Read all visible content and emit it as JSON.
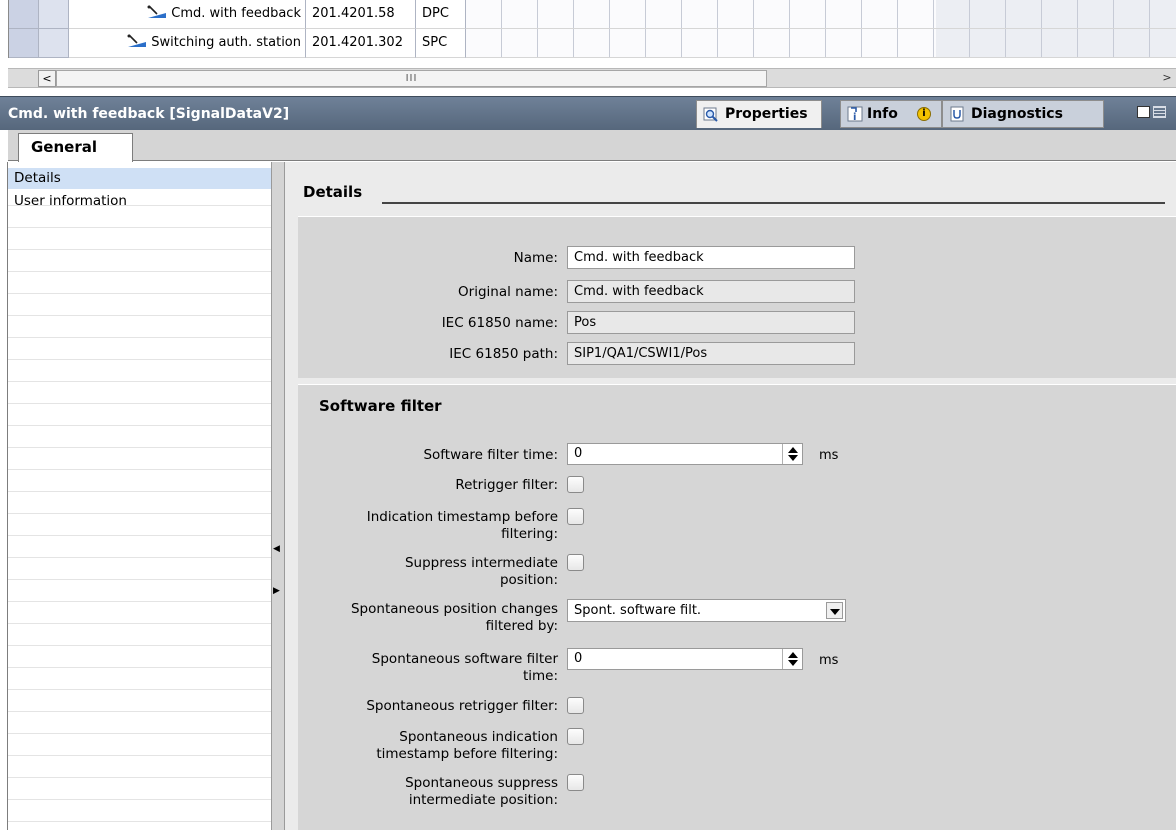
{
  "signal_table": {
    "rows": [
      {
        "name": "Cmd. with feedback",
        "address": "201.4201.58",
        "type": "DPC"
      },
      {
        "name": "Switching auth. station",
        "address": "201.4201.302",
        "type": "SPC"
      }
    ],
    "scroll_left_glyph": "<",
    "scroll_right_glyph": ">",
    "scroll_thumb_glyph": "III"
  },
  "inspector": {
    "title": "Cmd. with feedback [SignalDataV2]",
    "tabs": {
      "properties": "Properties",
      "info": "Info",
      "info_badge": "i",
      "diagnostics": "Diagnostics"
    },
    "general_tab": "General"
  },
  "left_nav": {
    "items": [
      {
        "label": "Details",
        "selected": true
      },
      {
        "label": "User information",
        "selected": false
      }
    ]
  },
  "details": {
    "heading": "Details",
    "name_label": "Name:",
    "name_value": "Cmd. with feedback",
    "original_name_label": "Original name:",
    "original_name_value": "Cmd. with feedback",
    "iec_name_label": "IEC 61850 name:",
    "iec_name_value": "Pos",
    "iec_path_label": "IEC 61850 path:",
    "iec_path_value": "SIP1/QA1/CSWI1/Pos"
  },
  "software_filter": {
    "heading": "Software filter",
    "filter_time_label": "Software filter time:",
    "filter_time_value": "0",
    "filter_time_unit": "ms",
    "retrigger_label": "Retrigger filter:",
    "timestamp_label_1": "Indication timestamp before",
    "timestamp_label_2": "filtering:",
    "suppress_label_1": "Suppress intermediate",
    "suppress_label_2": "position:",
    "spont_changes_label_1": "Spontaneous position changes",
    "spont_changes_label_2": "filtered by:",
    "spont_changes_value": "Spont. software filt.",
    "spont_time_label_1": "Spontaneous software filter",
    "spont_time_label_2": "time:",
    "spont_time_value": "0",
    "spont_time_unit": "ms",
    "spont_retrigger_label": "Spontaneous retrigger filter:",
    "spont_timestamp_label_1": "Spontaneous indication",
    "spont_timestamp_label_2": "timestamp before filtering:",
    "spont_suppress_label_1": "Spontaneous suppress",
    "spont_suppress_label_2": "intermediate position:"
  },
  "colors": {
    "header_bar": "#5f7189",
    "selected_nav": "#cfe0f5",
    "group_bg": "#d6d6d6"
  },
  "icons": {
    "signal_row": "switch-signal-icon",
    "properties_tab": "magnifier-icon",
    "info_tab": "info-icon",
    "diagnostics_tab": "diagnostics-icon"
  }
}
